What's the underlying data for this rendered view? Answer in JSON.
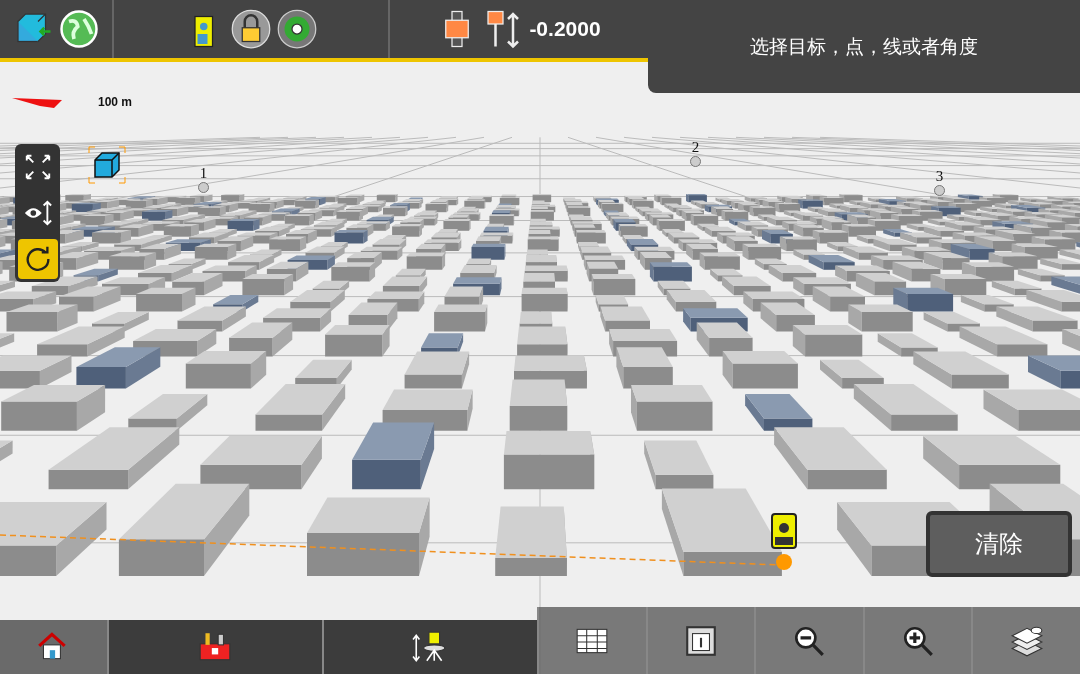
{
  "top_bar": {
    "height_value": "-0.2000"
  },
  "prompt": "选择目标，点，线或者角度",
  "scale": {
    "label": "100 m"
  },
  "view_tools": [
    {
      "kind": "extents",
      "selected": false
    },
    {
      "kind": "eye",
      "selected": false
    },
    {
      "kind": "orbit",
      "selected": true
    }
  ],
  "points": [
    {
      "label": "1"
    },
    {
      "label": "2"
    },
    {
      "label": "3"
    }
  ],
  "clear_button": "清除",
  "bottom_bar": [
    {
      "kind": "home",
      "dark": false
    },
    {
      "kind": "toolbox",
      "dark": true
    },
    {
      "kind": "instrument",
      "dark": true
    },
    {
      "kind": "table",
      "dark": false
    },
    {
      "kind": "info",
      "dark": false
    },
    {
      "kind": "zoom-out",
      "dark": false
    },
    {
      "kind": "zoom-in",
      "dark": false
    },
    {
      "kind": "layers",
      "dark": false
    }
  ]
}
